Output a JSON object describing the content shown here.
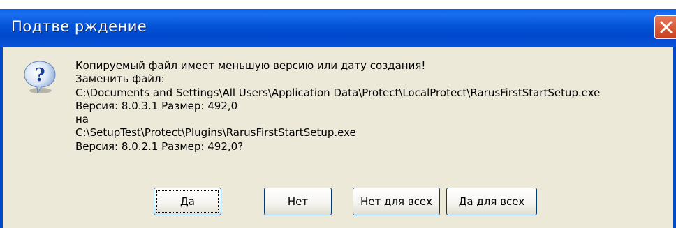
{
  "dialog": {
    "title": "Подтве рждение",
    "message_lines": [
      "Копируемый файл имеет меньшую версию или дату создания!",
      "Заменить файл:",
      "C:\\Documents and Settings\\All Users\\Application Data\\Protect\\LocalProtect\\RarusFirstStartSetup.exe",
      "Версия: 8.0.3.1   Размер: 492,0",
      "на",
      "C:\\SetupTest\\Protect\\Plugins\\RarusFirstStartSetup.exe",
      "Версия: 8.0.2.1   Размер: 492,0?"
    ],
    "icon": "question-icon",
    "buttons": {
      "yes": {
        "mnemonic": "Д",
        "rest": "а"
      },
      "no": {
        "mnemonic": "Н",
        "rest": "ет"
      },
      "no_all": {
        "pre": "Н",
        "mnemonic": "е",
        "rest": "т для всех"
      },
      "yes_all": {
        "mnemonic": "Д",
        "rest": "а для всех"
      }
    }
  },
  "colors": {
    "titlebar": "#0453d6",
    "body": "#ece9d8",
    "close": "#c8401c"
  }
}
